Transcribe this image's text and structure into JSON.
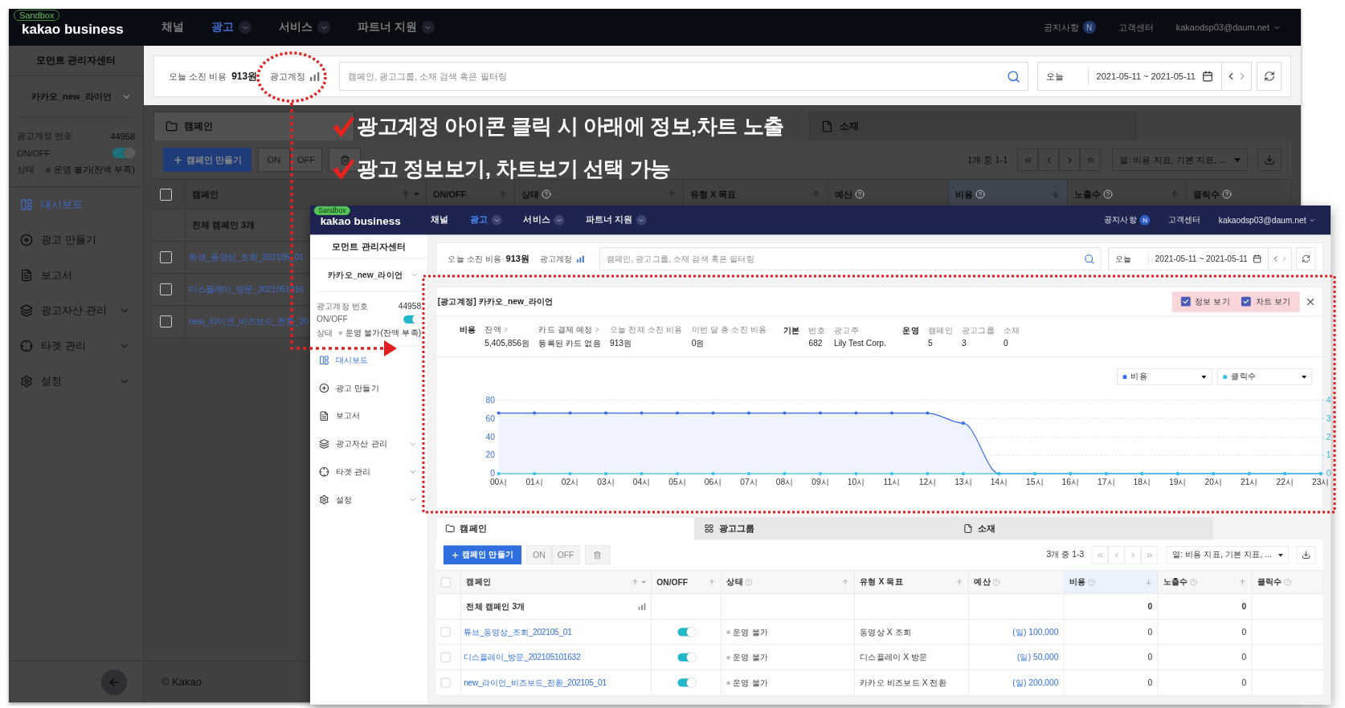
{
  "background_screen": {
    "header": {
      "badge": "Sandbox",
      "logo": "kakao business",
      "nav": [
        {
          "label": "채널",
          "selected": false,
          "dropdown": false
        },
        {
          "label": "광고",
          "selected": true,
          "dropdown": true
        },
        {
          "label": "서비스",
          "selected": false,
          "dropdown": true
        },
        {
          "label": "파트너 지원",
          "selected": false,
          "dropdown": true
        }
      ],
      "notice": "공지사항",
      "notice_badge": "N",
      "support": "고객센터",
      "account": "kakaodsp03@daum.net"
    },
    "sidebar": {
      "title": "모먼트 관리자센터",
      "account": "카카오_new_라이언",
      "info": [
        {
          "kind": "text",
          "label": "광고계정 번호",
          "value": "44958"
        },
        {
          "kind": "toggle",
          "label": "ON/OFF",
          "on": true
        },
        {
          "kind": "status",
          "label": "상태",
          "value": "운영 불가(잔액 부족)"
        }
      ],
      "menu": [
        {
          "label": "대시보드",
          "selected": true,
          "expandable": false
        },
        {
          "label": "광고 만들기",
          "selected": false,
          "expandable": false
        },
        {
          "label": "보고서",
          "selected": false,
          "expandable": false
        },
        {
          "label": "광고자산 관리",
          "selected": false,
          "expandable": true
        },
        {
          "label": "타겟 관리",
          "selected": false,
          "expandable": true
        },
        {
          "label": "설정",
          "selected": false,
          "expandable": true
        }
      ]
    },
    "toolbar": {
      "spend_label": "오늘 소진 비용",
      "spend_value": "913원",
      "account_label": "광고계정",
      "account_chart_selected": false,
      "search_placeholder": "캠페인, 광고그룹, 소재 검색 혹은 필터링",
      "period": "오늘",
      "date_range": "2021-05-11 ~ 2021-05-11"
    },
    "tabs": [
      {
        "label": "캠페인",
        "selected": true
      },
      {
        "label": "소재",
        "selected": false
      }
    ],
    "actions": {
      "create": "캠페인 만들기",
      "on": "ON",
      "off": "OFF",
      "count": "1개 중 1-1",
      "columns": "열: 비용 지표, 기본 지표, ..."
    },
    "table": {
      "select_all_checked": false,
      "columns": [
        {
          "label": "캠페인",
          "help": false,
          "sortable": true,
          "menu": true,
          "selected": false
        },
        {
          "label": "ON/OFF",
          "help": false,
          "sortable": true,
          "menu": false,
          "selected": false
        },
        {
          "label": "상태",
          "help": true,
          "sortable": true,
          "menu": false,
          "selected": false
        },
        {
          "label": "유형 X 목표",
          "help": false,
          "sortable": true,
          "menu": false,
          "selected": false
        },
        {
          "label": "예산",
          "help": true,
          "sortable": false,
          "menu": false,
          "selected": false
        },
        {
          "label": "비용",
          "help": true,
          "sortable": true,
          "menu": false,
          "selected": true
        },
        {
          "label": "노출수",
          "help": true,
          "sortable": true,
          "menu": false,
          "selected": false
        },
        {
          "label": "클릭수",
          "help": true,
          "sortable": false,
          "menu": false,
          "selected": false
        }
      ],
      "summary": {
        "name": "전체 캠페인 3개"
      },
      "rows": [
        {
          "checked": false,
          "name": "튜브_동영상_조회_202105_01"
        },
        {
          "checked": false,
          "name": "디스플레이_방문_2021051016"
        },
        {
          "checked": false,
          "name": "new_라이언_비즈보드_전환_20"
        }
      ]
    },
    "footer": "© Kakao"
  },
  "annotations": [
    "광고계정 아이콘 클릭 시 아래에 정보,차트 노출",
    "광고 정보보기, 차트보기 선택 가능"
  ],
  "inset_screen": {
    "header": {
      "badge": "Sandbox",
      "logo": "kakao business",
      "nav": [
        {
          "label": "채널",
          "selected": false,
          "dropdown": false
        },
        {
          "label": "광고",
          "selected": true,
          "dropdown": true
        },
        {
          "label": "서비스",
          "selected": false,
          "dropdown": true
        },
        {
          "label": "파트너 지원",
          "selected": false,
          "dropdown": true
        }
      ],
      "notice": "공지사항",
      "notice_badge": "N",
      "support": "고객센터",
      "account": "kakaodsp03@daum.net"
    },
    "sidebar": {
      "title": "모먼트 관리자센터",
      "account": "카카오_new_라이언",
      "info": [
        {
          "kind": "text",
          "label": "광고계정 번호",
          "value": "44958"
        },
        {
          "kind": "toggle",
          "label": "ON/OFF",
          "on": true
        },
        {
          "kind": "status",
          "label": "상태",
          "value": "운영 불가(잔액 부족)"
        }
      ],
      "menu": [
        {
          "label": "대시보드",
          "selected": true,
          "expandable": false
        },
        {
          "label": "광고 만들기",
          "selected": false,
          "expandable": false
        },
        {
          "label": "보고서",
          "selected": false,
          "expandable": false
        },
        {
          "label": "광고자산 관리",
          "selected": false,
          "expandable": true
        },
        {
          "label": "타겟 관리",
          "selected": false,
          "expandable": true
        },
        {
          "label": "설정",
          "selected": false,
          "expandable": true
        }
      ]
    },
    "toolbar": {
      "spend_label": "오늘 소진 비용",
      "spend_value": "913원",
      "account_label": "광고계정",
      "account_chart_selected": true,
      "search_placeholder": "캠페인, 광고그룹, 소재 검색 혹은 필터링",
      "period": "오늘",
      "date_range": "2021-05-11 ~ 2021-05-11"
    },
    "info_panel": {
      "title": "[광고계정] 카카오_new_라이언",
      "options": [
        {
          "label": "정보 보기",
          "checked": true
        },
        {
          "label": "차트 보기",
          "checked": true
        }
      ],
      "groups": [
        {
          "title": "비용",
          "items": [
            {
              "label": "잔액",
              "link": true,
              "value": "5,405,856원"
            },
            {
              "label": "카드 결제 예정",
              "link": true,
              "value": "등록된 카드 없음"
            },
            {
              "label": "오늘 전체 소진 비용",
              "link": false,
              "value": "913원"
            },
            {
              "label": "이번 달 총 소진 비용",
              "link": false,
              "value": "0원"
            }
          ]
        },
        {
          "title": "기본",
          "items": [
            {
              "label": "번호",
              "link": false,
              "value": "682"
            },
            {
              "label": "광고주",
              "link": false,
              "value": "Lily Test Corp."
            }
          ]
        },
        {
          "title": "운영",
          "items": [
            {
              "label": "캠페인",
              "link": false,
              "value": "5"
            },
            {
              "label": "광고그룹",
              "link": false,
              "value": "3"
            },
            {
              "label": "소재",
              "link": false,
              "value": "0"
            }
          ]
        }
      ],
      "chart_data": {
        "type": "line",
        "categories": [
          "00시",
          "01시",
          "02시",
          "03시",
          "04시",
          "05시",
          "06시",
          "07시",
          "08시",
          "09시",
          "10시",
          "11시",
          "12시",
          "13시",
          "14시",
          "15시",
          "16시",
          "17시",
          "18시",
          "19시",
          "20시",
          "21시",
          "22시",
          "23시"
        ],
        "series": [
          {
            "name": "비용",
            "color": "#3a6ee8",
            "values": [
              66,
              66,
              66,
              66,
              66,
              66,
              66,
              66,
              66,
              66,
              66,
              66,
              66,
              55,
              0,
              0,
              0,
              0,
              0,
              0,
              0,
              0,
              0,
              0
            ]
          },
          {
            "name": "클릭수",
            "color": "#3fc3e8",
            "values": [
              0,
              0,
              0,
              0,
              0,
              0,
              0,
              0,
              0,
              0,
              0,
              0,
              0,
              0,
              0,
              0,
              0,
              0,
              0,
              0,
              0,
              0,
              0,
              0
            ]
          }
        ],
        "ylim": [
          0,
          80
        ],
        "yticks": [
          0,
          20,
          40,
          60,
          80
        ],
        "grid": true
      },
      "right_axis_labels": [
        "4",
        "3",
        "2",
        "1",
        "0"
      ]
    },
    "tabs": [
      {
        "label": "캠페인",
        "selected": true
      },
      {
        "label": "광고그룹",
        "selected": false
      },
      {
        "label": "소재",
        "selected": false
      }
    ],
    "actions": {
      "create": "캠페인 만들기",
      "on": "ON",
      "off": "OFF",
      "count": "3개 중 1-3",
      "columns": "열: 비용 지표, 기본 지표, ..."
    },
    "table": {
      "select_all_checked": false,
      "columns": [
        {
          "label": "캠페인",
          "help": false,
          "sortable": true,
          "menu": true,
          "selected": false
        },
        {
          "label": "ON/OFF",
          "help": false,
          "sortable": true,
          "menu": false,
          "selected": false
        },
        {
          "label": "상태",
          "help": true,
          "sortable": true,
          "menu": false,
          "selected": false
        },
        {
          "label": "유형 X 목표",
          "help": false,
          "sortable": true,
          "menu": false,
          "selected": false
        },
        {
          "label": "예산",
          "help": true,
          "sortable": false,
          "menu": false,
          "selected": false
        },
        {
          "label": "비용",
          "help": true,
          "sortable": true,
          "menu": false,
          "selected": true
        },
        {
          "label": "노출수",
          "help": true,
          "sortable": true,
          "menu": false,
          "selected": false
        },
        {
          "label": "클릭수",
          "help": true,
          "sortable": false,
          "menu": false,
          "selected": false
        }
      ],
      "summary": {
        "name": "전체 캠페인 3개",
        "cost": "0",
        "impressions": "0"
      },
      "rows": [
        {
          "checked": false,
          "name": "튜브_동영상_조회_202105_01",
          "on": true,
          "status": "운영 불가",
          "type": "동영상 X 조회",
          "budget": "(일) 100,000",
          "cost": "0",
          "impressions": "0"
        },
        {
          "checked": false,
          "name": "디스플레이_방문_202105101632",
          "on": true,
          "status": "운영 불가",
          "type": "디스플레이 X 방문",
          "budget": "(일) 50,000",
          "cost": "0",
          "impressions": "0"
        },
        {
          "checked": false,
          "name": "new_라이언_비즈보드_전환_202105_01",
          "on": true,
          "status": "운영 불가",
          "type": "카카오 비즈보드 X 전환",
          "budget": "(일) 200,000",
          "cost": "0",
          "impressions": "0"
        }
      ]
    }
  }
}
